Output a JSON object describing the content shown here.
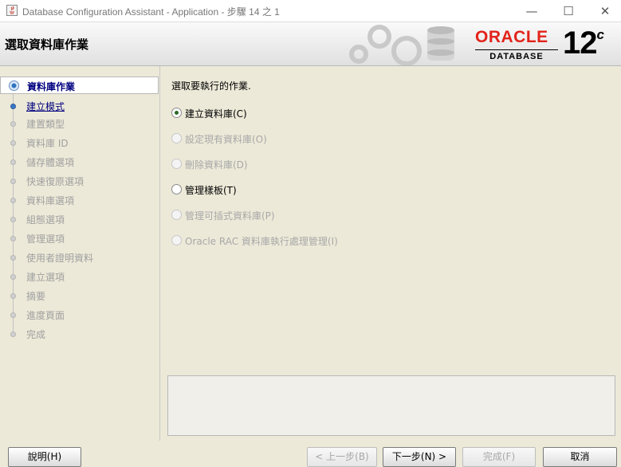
{
  "window": {
    "title": "Database Configuration Assistant - Application - 步驟 14 之 1",
    "controls": {
      "minimize": "—",
      "maximize": "☐",
      "close": "✕"
    }
  },
  "header": {
    "title": "選取資料庫作業",
    "logo_brand": "ORACLE",
    "logo_sub": "DATABASE",
    "version_num": "12",
    "version_suffix": "c"
  },
  "sidebar": {
    "items": [
      {
        "label": "資料庫作業"
      },
      {
        "label": "建立模式"
      },
      {
        "label": "建置類型"
      },
      {
        "label": "資料庫 ID"
      },
      {
        "label": "儲存體選項"
      },
      {
        "label": "快速復原選項"
      },
      {
        "label": "資料庫選項"
      },
      {
        "label": "組態選項"
      },
      {
        "label": "管理選項"
      },
      {
        "label": "使用者證明資料"
      },
      {
        "label": "建立選項"
      },
      {
        "label": "摘要"
      },
      {
        "label": "進度頁面"
      },
      {
        "label": "完成"
      }
    ]
  },
  "main": {
    "prompt": "選取要執行的作業.",
    "options": [
      {
        "label": "建立資料庫(C)",
        "checked": true,
        "enabled": true
      },
      {
        "label": "設定現有資料庫(O)",
        "checked": false,
        "enabled": false
      },
      {
        "label": "刪除資料庫(D)",
        "checked": false,
        "enabled": false
      },
      {
        "label": "管理樣板(T)",
        "checked": false,
        "enabled": true
      },
      {
        "label": "管理可插式資料庫(P)",
        "checked": false,
        "enabled": false
      },
      {
        "label": "Oracle RAC 資料庫執行處理管理(I)",
        "checked": false,
        "enabled": false
      }
    ]
  },
  "footer": {
    "help": "說明(H)",
    "back": "< 上一步(B)",
    "next": "下一步(N) >",
    "finish": "完成(F)",
    "cancel": "取消"
  }
}
